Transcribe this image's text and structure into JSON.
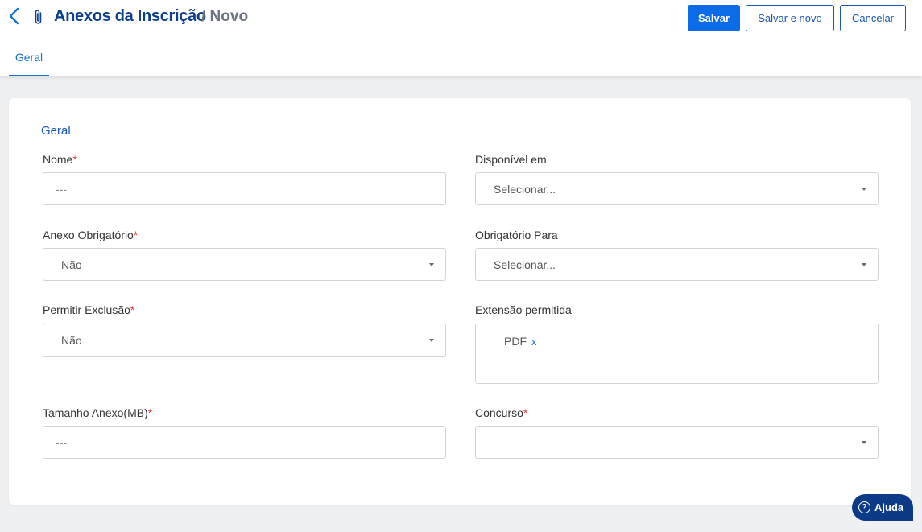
{
  "header": {
    "title": "Anexos da Inscrição",
    "subtitle": "/ Novo",
    "buttons": {
      "save": "Salvar",
      "save_new": "Salvar e novo",
      "cancel": "Cancelar"
    }
  },
  "tabs": [
    {
      "label": "Geral",
      "active": true
    }
  ],
  "form": {
    "section_title": "Geral",
    "required_mark": "*",
    "fields": {
      "nome": {
        "label": "Nome",
        "required": true,
        "placeholder": "---",
        "value": ""
      },
      "disponivel_em": {
        "label": "Disponível em",
        "required": false,
        "value": "Selecionar..."
      },
      "anexo_obrigatorio": {
        "label": "Anexo Obrigatório",
        "required": true,
        "value": "Não"
      },
      "obrigatorio_para": {
        "label": "Obrigatório Para",
        "required": false,
        "value": "Selecionar..."
      },
      "permitir_exclusao": {
        "label": "Permitir Exclusão",
        "required": true,
        "value": "Não"
      },
      "extensao_permitida": {
        "label": "Extensão permitida",
        "required": false,
        "tags": [
          "PDF"
        ],
        "remove_glyph": "x"
      },
      "tamanho_anexo": {
        "label": "Tamanho Anexo(MB)",
        "required": true,
        "placeholder": "---",
        "value": ""
      },
      "concurso": {
        "label": "Concurso",
        "required": true,
        "value": ""
      }
    }
  },
  "help": {
    "label": "Ajuda",
    "icon": "question-circle-icon",
    "icon_glyph": "?"
  },
  "colors": {
    "primary": "#0b6be8",
    "title": "#0d3f8f",
    "required": "#e53935",
    "help_bg": "#0c3a86"
  }
}
